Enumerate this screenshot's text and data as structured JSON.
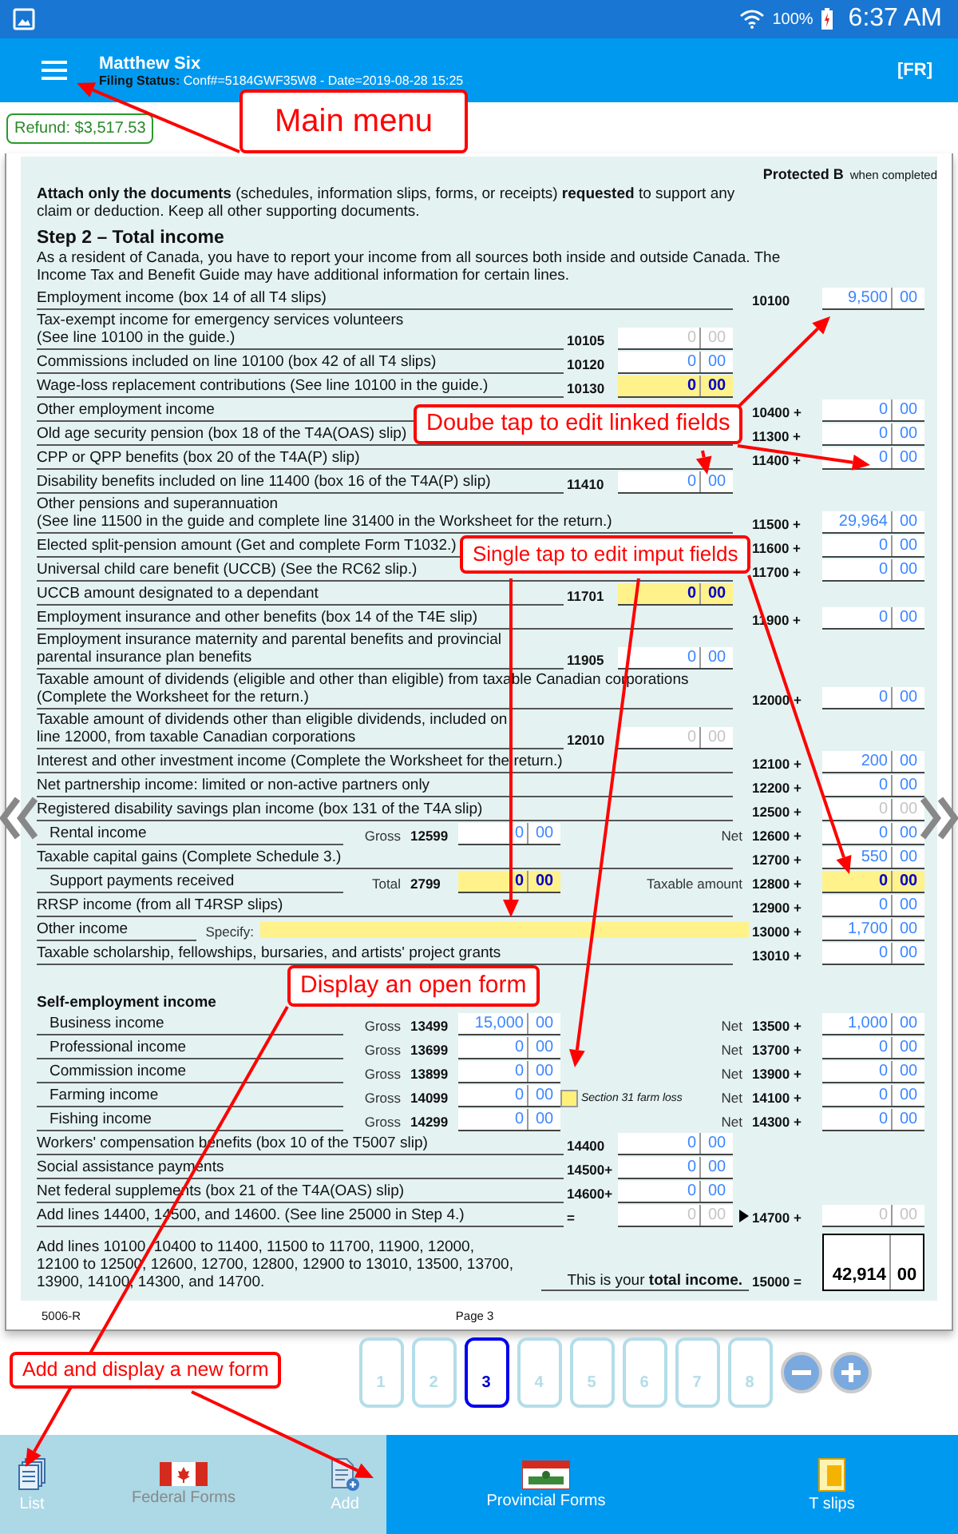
{
  "status_bar": {
    "battery": "100%",
    "time": "6:37 AM"
  },
  "app_bar": {
    "name": "Matthew Six",
    "status_label": "Filing Status:",
    "status_value": "Conf#=5184GWF35W8 - Date=2019-08-28 15:25",
    "language": "[FR]"
  },
  "refund": "Refund: $3,517.53",
  "form": {
    "protected": "Protected B",
    "protected_note": "when completed",
    "intro": "**Attach only the documents** (schedules, information slips, forms, or receipts) **requested** to support any claim or deduction. Keep all other supporting documents.",
    "step_title": "Step 2 – Total income",
    "step_text": "As a resident of Canada, you have to report your income from all sources both inside and outside Canada. The Income Tax and Benefit Guide may have additional information for certain lines.",
    "rows": [
      {
        "kind": "line",
        "label": "Employment income (box 14 of all T4 slips)",
        "outer": {
          "code": "10100",
          "amount": {
            "whole": "9,500",
            "cents": "00",
            "input": false,
            "disabled": false
          }
        }
      },
      {
        "kind": "line",
        "label": "Tax-exempt income for emergency services volunteers\n(See line 10100 in the guide.)",
        "inner": {
          "code": "10105",
          "amount": {
            "whole": "0",
            "cents": "00",
            "input": false,
            "disabled": true
          }
        }
      },
      {
        "kind": "line",
        "label": "Commissions included on line 10100 (box 42 of all T4 slips)",
        "inner": {
          "code": "10120",
          "amount": {
            "whole": "0",
            "cents": "00",
            "input": false,
            "disabled": false
          }
        }
      },
      {
        "kind": "line",
        "label": "Wage-loss replacement contributions (See line 10100 in the guide.)",
        "inner": {
          "code": "10130",
          "amount": {
            "whole": "0",
            "cents": "00",
            "input": true,
            "disabled": false
          }
        }
      },
      {
        "kind": "line",
        "label": "Other employment income",
        "outer": {
          "code": "10400",
          "sign": "+",
          "amount": {
            "whole": "0",
            "cents": "00",
            "input": false,
            "disabled": false
          }
        }
      },
      {
        "kind": "line",
        "label": "Old age security pension (box 18 of the T4A(OAS) slip)",
        "outer": {
          "code": "11300",
          "sign": "+",
          "amount": {
            "whole": "0",
            "cents": "00",
            "input": false,
            "disabled": false
          }
        }
      },
      {
        "kind": "line",
        "label": "CPP or QPP benefits (box 20 of the T4A(P) slip)",
        "outer": {
          "code": "11400",
          "sign": "+",
          "amount": {
            "whole": "0",
            "cents": "00",
            "input": false,
            "disabled": false
          }
        }
      },
      {
        "kind": "line",
        "label": "Disability benefits included on line 11400 (box 16 of the T4A(P) slip)",
        "inner": {
          "code": "11410",
          "amount": {
            "whole": "0",
            "cents": "00",
            "input": false,
            "disabled": false
          }
        }
      },
      {
        "kind": "line",
        "label": "Other pensions and superannuation\n(See line 11500 in the guide and complete line 31400 in the Worksheet for the return.)",
        "outer": {
          "code": "11500",
          "sign": "+",
          "amount": {
            "whole": "29,964",
            "cents": "00",
            "input": false,
            "disabled": false
          }
        }
      },
      {
        "kind": "line",
        "label": "Elected split-pension amount (Get and complete Form T1032.)",
        "outer": {
          "code": "11600",
          "sign": "+",
          "amount": {
            "whole": "0",
            "cents": "00",
            "input": false,
            "disabled": false
          }
        }
      },
      {
        "kind": "line",
        "label": "Universal child care benefit (UCCB) (See the RC62 slip.)",
        "outer": {
          "code": "11700",
          "sign": "+",
          "amount": {
            "whole": "0",
            "cents": "00",
            "input": false,
            "disabled": false
          }
        }
      },
      {
        "kind": "line",
        "label": "UCCB amount designated to a dependant",
        "inner": {
          "code": "11701",
          "amount": {
            "whole": "0",
            "cents": "00",
            "input": true,
            "disabled": false
          }
        }
      },
      {
        "kind": "line",
        "label": "Employment insurance and other benefits (box 14 of the T4E slip)",
        "outer": {
          "code": "11900",
          "sign": "+",
          "amount": {
            "whole": "0",
            "cents": "00",
            "input": false,
            "disabled": false
          }
        }
      },
      {
        "kind": "line",
        "label": "Employment insurance maternity and parental benefits and provincial\nparental insurance plan benefits",
        "inner": {
          "code": "11905",
          "amount": {
            "whole": "0",
            "cents": "00",
            "input": false,
            "disabled": false
          }
        }
      },
      {
        "kind": "line",
        "label": "Taxable amount of dividends (eligible and other than eligible) from taxable Canadian corporations\n(Complete the Worksheet for the return.)",
        "outer": {
          "code": "12000",
          "sign": "+",
          "amount": {
            "whole": "0",
            "cents": "00",
            "input": false,
            "disabled": false
          }
        }
      },
      {
        "kind": "line",
        "label": "Taxable amount of dividends other than eligible dividends, included on\nline 12000, from taxable Canadian corporations",
        "inner": {
          "code": "12010",
          "amount": {
            "whole": "0",
            "cents": "00",
            "input": false,
            "disabled": true
          }
        }
      },
      {
        "kind": "line",
        "label": "Interest and other investment income (Complete the Worksheet for the return.)",
        "outer": {
          "code": "12100",
          "sign": "+",
          "amount": {
            "whole": "200",
            "cents": "00",
            "input": false,
            "disabled": false
          }
        }
      },
      {
        "kind": "line",
        "label": "Net partnership income: limited or non-active partners only",
        "outer": {
          "code": "12200",
          "sign": "+",
          "amount": {
            "whole": "0",
            "cents": "00",
            "input": false,
            "disabled": false
          }
        }
      },
      {
        "kind": "line",
        "label": "Registered disability savings plan income (box 131 of the T4A slip)",
        "outer": {
          "code": "12500",
          "sign": "+",
          "amount": {
            "whole": "0",
            "cents": "00",
            "input": false,
            "disabled": true
          }
        }
      },
      {
        "kind": "split",
        "label": "Rental income",
        "left_label": "Gross",
        "left_code": "12599",
        "left_amount": {
          "whole": "0",
          "cents": "00",
          "input": false,
          "disabled": false
        },
        "right_label": "Net",
        "right_code": "12600",
        "right_sign": "+",
        "right_amount": {
          "whole": "0",
          "cents": "00",
          "input": false,
          "disabled": false
        }
      },
      {
        "kind": "line",
        "label": "Taxable capital gains (Complete Schedule 3.)",
        "outer": {
          "code": "12700",
          "sign": "+",
          "amount": {
            "whole": "550",
            "cents": "00",
            "input": false,
            "disabled": false
          }
        }
      },
      {
        "kind": "split",
        "label": "Support payments received",
        "left_label": "Total",
        "left_code": "2799",
        "left_amount": {
          "whole": "0",
          "cents": "00",
          "input": true,
          "disabled": false
        },
        "right_label": "Taxable amount",
        "right_code": "12800",
        "right_sign": "+",
        "right_amount": {
          "whole": "0",
          "cents": "00",
          "input": true,
          "disabled": false
        }
      },
      {
        "kind": "line",
        "label": "RRSP income (from all T4RSP slips)",
        "outer": {
          "code": "12900",
          "sign": "+",
          "amount": {
            "whole": "0",
            "cents": "00",
            "input": false,
            "disabled": false
          }
        }
      },
      {
        "kind": "specify",
        "label": "Other income",
        "specify_label": "Specify:",
        "code": "13000",
        "sign": "+",
        "amount": {
          "whole": "1,700",
          "cents": "00",
          "input": false,
          "disabled": false
        }
      },
      {
        "kind": "line",
        "label": "Taxable scholarship, fellowships, bursaries, and artists' project grants",
        "outer": {
          "code": "13010",
          "sign": "+",
          "amount": {
            "whole": "0",
            "cents": "00",
            "input": false,
            "disabled": false
          }
        }
      },
      {
        "kind": "heading",
        "label": "Self-employment income"
      },
      {
        "kind": "split",
        "label": "Business income",
        "left_label": "Gross",
        "left_code": "13499",
        "left_amount": {
          "whole": "15,000",
          "cents": "00",
          "input": false,
          "disabled": false
        },
        "right_label": "Net",
        "right_code": "13500",
        "right_sign": "+",
        "right_amount": {
          "whole": "1,000",
          "cents": "00",
          "input": false,
          "disabled": false
        }
      },
      {
        "kind": "split",
        "label": "Professional income",
        "left_label": "Gross",
        "left_code": "13699",
        "left_amount": {
          "whole": "0",
          "cents": "00",
          "input": false,
          "disabled": false
        },
        "right_label": "Net",
        "right_code": "13700",
        "right_sign": "+",
        "right_amount": {
          "whole": "0",
          "cents": "00",
          "input": false,
          "disabled": false
        }
      },
      {
        "kind": "split",
        "label": "Commission income",
        "left_label": "Gross",
        "left_code": "13899",
        "left_amount": {
          "whole": "0",
          "cents": "00",
          "input": false,
          "disabled": false
        },
        "right_label": "Net",
        "right_code": "13900",
        "right_sign": "+",
        "right_amount": {
          "whole": "0",
          "cents": "00",
          "input": false,
          "disabled": false
        }
      },
      {
        "kind": "split",
        "label": "Farming income",
        "left_label": "Gross",
        "left_code": "14099",
        "left_amount": {
          "whole": "0",
          "cents": "00",
          "input": false,
          "disabled": false
        },
        "checkbox": {
          "label": "Section 31 farm loss",
          "checked": false
        },
        "right_label": "Net",
        "right_code": "14100",
        "right_sign": "+",
        "right_amount": {
          "whole": "0",
          "cents": "00",
          "input": false,
          "disabled": false
        }
      },
      {
        "kind": "split",
        "label": "Fishing income",
        "left_label": "Gross",
        "left_code": "14299",
        "left_amount": {
          "whole": "0",
          "cents": "00",
          "input": false,
          "disabled": false
        },
        "right_label": "Net",
        "right_code": "14300",
        "right_sign": "+",
        "right_amount": {
          "whole": "0",
          "cents": "00",
          "input": false,
          "disabled": false
        }
      },
      {
        "kind": "line",
        "label": "Workers' compensation benefits (box 10 of the T5007 slip)",
        "inner": {
          "code": "14400",
          "amount": {
            "whole": "0",
            "cents": "00",
            "input": false,
            "disabled": false
          }
        }
      },
      {
        "kind": "line",
        "label": "Social assistance payments",
        "inner": {
          "code": "14500",
          "sign": "+",
          "amount": {
            "whole": "0",
            "cents": "00",
            "input": false,
            "disabled": false
          }
        }
      },
      {
        "kind": "line",
        "label": "Net federal supplements (box 21 of the T4A(OAS) slip)",
        "inner": {
          "code": "14600",
          "sign": "+",
          "amount": {
            "whole": "0",
            "cents": "00",
            "input": false,
            "disabled": false
          }
        }
      },
      {
        "kind": "line",
        "label": "Add lines 14400, 14500, and 14600. (See line 25000 in Step 4.)",
        "inner": {
          "sign": "=",
          "amount": {
            "whole": "0",
            "cents": "00",
            "input": false,
            "disabled": true
          }
        },
        "pointer": true,
        "outer": {
          "code": "14700",
          "sign": "+",
          "amount": {
            "whole": "0",
            "cents": "00",
            "input": false,
            "disabled": true
          }
        }
      },
      {
        "kind": "total",
        "label": "Add lines 10100, 10400 to 11400, 11500 to 11700, 11900, 12000,\n12100 to 12500, 12600, 12700, 12800, 12900 to 13010, 13500, 13700,\n13900, 14100, 14300, and 14700.",
        "note": "This is your **total income.**",
        "code": "15000",
        "sign": "=",
        "amount": {
          "whole": "42,914",
          "cents": "00"
        }
      }
    ],
    "form_code": "5006-R",
    "page_label": "Page 3"
  },
  "pages": [
    {
      "label": "1",
      "selected": false
    },
    {
      "label": "2",
      "selected": false
    },
    {
      "label": "3",
      "selected": true
    },
    {
      "label": "4",
      "selected": false
    },
    {
      "label": "5",
      "selected": false
    },
    {
      "label": "6",
      "selected": false
    },
    {
      "label": "7",
      "selected": false
    },
    {
      "label": "8",
      "selected": false
    }
  ],
  "bottom_nav": [
    {
      "kind": "tool",
      "label": "List"
    },
    {
      "kind": "tab",
      "label": "Federal Forms",
      "selected": true
    },
    {
      "kind": "tool",
      "label": "Add"
    },
    {
      "kind": "tab",
      "label": "Provincial Forms",
      "selected": false
    },
    {
      "kind": "tab",
      "label": "T slips",
      "selected": false
    }
  ],
  "callouts": [
    "Main menu",
    "Doube tap to edit linked fields",
    "Single tap to edit imput fields",
    "Display an open form",
    "Add and display a new form"
  ]
}
